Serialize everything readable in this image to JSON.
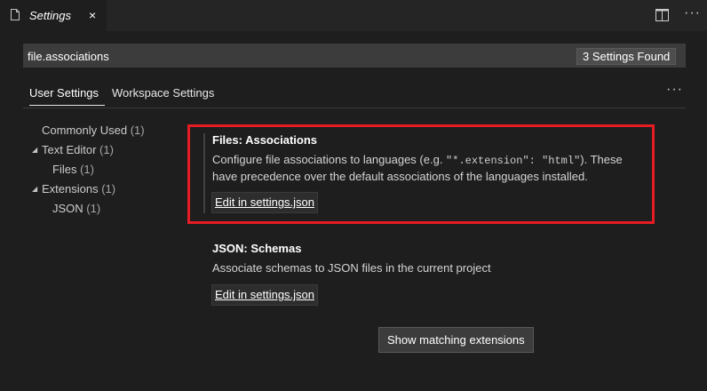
{
  "tab": {
    "title": "Settings",
    "close": "×"
  },
  "editor_actions": {
    "more": "···"
  },
  "search": {
    "value": "file.associations",
    "count": "3 Settings Found"
  },
  "scopes": {
    "user": "User Settings",
    "workspace": "Workspace Settings",
    "more": "···"
  },
  "toc": [
    {
      "label": "Commonly Used",
      "count": "(1)"
    },
    {
      "label": "Text Editor",
      "count": "(1)",
      "arrow": "◢"
    },
    {
      "label": "Files",
      "count": "(1)"
    },
    {
      "label": "Extensions",
      "count": "(1)",
      "arrow": "◢"
    },
    {
      "label": "JSON",
      "count": "(1)"
    }
  ],
  "settings": [
    {
      "title": "Files: Associations",
      "desc_prefix": "Configure file associations to languages (e.g. ",
      "desc_code": "\"*.extension\": \"html\"",
      "desc_suffix": "). These have precedence over the default associations of the languages installed.",
      "edit": "Edit in settings.json"
    },
    {
      "title": "JSON: Schemas",
      "desc": "Associate schemas to JSON files in the current project",
      "edit": "Edit in settings.json"
    }
  ],
  "show_extensions": "Show matching extensions",
  "colors": {
    "highlight": "#e51c23",
    "background": "#1e1e1e"
  }
}
